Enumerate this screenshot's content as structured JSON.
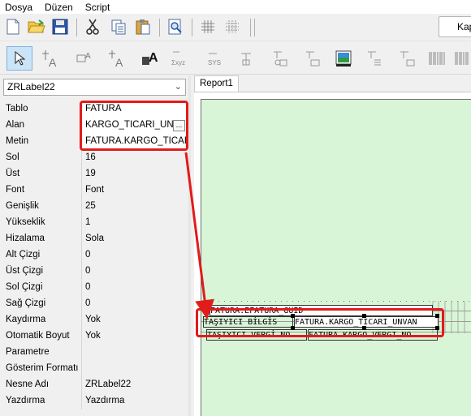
{
  "menu": {
    "items": [
      {
        "label": "Dosya"
      },
      {
        "label": "Düzen"
      },
      {
        "label": "Script"
      }
    ]
  },
  "toolbar": {
    "close_label": "Kapa"
  },
  "object_selector": {
    "value": "ZRLabel22"
  },
  "properties": [
    {
      "name": "Tablo",
      "value": "FATURA"
    },
    {
      "name": "Alan",
      "value": "KARGO_TICARI_UNVAN"
    },
    {
      "name": "Metin",
      "value": "FATURA.KARGO_TICARI_UNVAN"
    },
    {
      "name": "Sol",
      "value": "16"
    },
    {
      "name": "Üst",
      "value": "19"
    },
    {
      "name": "Font",
      "value": "Font"
    },
    {
      "name": "Genişlik",
      "value": "25"
    },
    {
      "name": "Yükseklik",
      "value": "1"
    },
    {
      "name": "Hizalama",
      "value": "Sola"
    },
    {
      "name": "Alt Çizgi",
      "value": "0"
    },
    {
      "name": "Üst Çizgi",
      "value": "0"
    },
    {
      "name": "Sol Çizgi",
      "value": "0"
    },
    {
      "name": "Sağ Çizgi",
      "value": "0"
    },
    {
      "name": "Kaydırma",
      "value": "Yok"
    },
    {
      "name": "Otomatik Boyut",
      "value": "Yok"
    },
    {
      "name": "Parametre",
      "value": ""
    },
    {
      "name": "Gösterim Formatı",
      "value": ""
    },
    {
      "name": "Nesne Adı",
      "value": "ZRLabel22"
    },
    {
      "name": "Yazdırma",
      "value": "Yazdırma"
    }
  ],
  "report": {
    "tab_label": "Report1",
    "rows": [
      {
        "cells": [
          "T",
          "FATURA.EFATURA_GUID"
        ]
      },
      {
        "cells": [
          "TAŞIYICI BİLGİS",
          "FATURA.KARGO_TICARI_UNVAN"
        ]
      },
      {
        "cells": [
          "TAŞIYICI VERGİ NO",
          "FATURA.KARGO_VERGI_NO"
        ]
      }
    ]
  },
  "colors": {
    "highlight": "#e21b1b",
    "report_page": "#d9f5d7"
  },
  "icons": [
    "new-document-icon",
    "open-folder-icon",
    "save-icon",
    "cut-icon",
    "copy-icon",
    "paste-icon",
    "preview-icon",
    "grid-icon",
    "align-grid-icon",
    "select-pointer-icon",
    "label-tool-icon",
    "db-label-icon",
    "sys-data-icon",
    "image-tool-icon",
    "barcode-icon"
  ]
}
